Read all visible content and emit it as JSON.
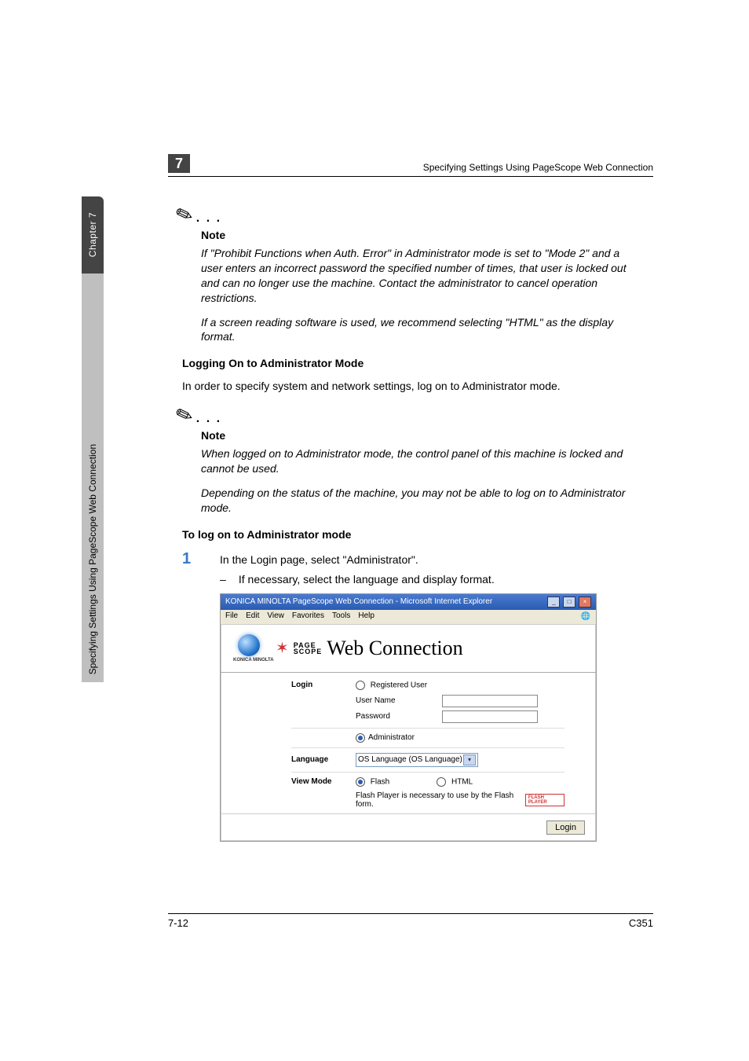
{
  "sidebar": {
    "chapter_label": "Chapter 7",
    "section_label": "Specifying Settings Using PageScope Web Connection"
  },
  "header": {
    "chapter_num": "7",
    "running_title": "Specifying Settings Using PageScope Web Connection"
  },
  "note1": {
    "label": "Note",
    "para1": "If \"Prohibit Functions when Auth. Error\" in Administrator mode is set to \"Mode 2\" and a user enters an incorrect password the specified number of times, that user is locked out and can no longer use the machine. Contact the administrator to cancel operation restrictions.",
    "para2": "If a screen reading software is used, we recommend selecting \"HTML\" as the display format."
  },
  "section1": {
    "heading": "Logging On to Administrator Mode",
    "body": "In order to specify system and network settings, log on to Administrator mode."
  },
  "note2": {
    "label": "Note",
    "para1": "When logged on to Administrator mode, the control panel of this machine is locked and cannot be used.",
    "para2": "Depending on the status of the machine, you may not be able to log on to Administrator mode."
  },
  "section2": {
    "heading": "To log on to Administrator mode"
  },
  "step1": {
    "num": "1",
    "text": "In the Login page, select \"Administrator\".",
    "sub": "If necessary, select the language and display format."
  },
  "screenshot": {
    "titlebar": "KONICA MINOLTA PageScope Web Connection - Microsoft Internet Explorer",
    "menu": {
      "file": "File",
      "edit": "Edit",
      "view": "View",
      "favorites": "Favorites",
      "tools": "Tools",
      "help": "Help"
    },
    "brand_logo_text": "KONICA MINOLTA",
    "brand_ps_line1": "PAGE",
    "brand_ps_line2": "SCOPE",
    "brand_product": "Web Connection",
    "login_label": "Login",
    "registered_user": "Registered User",
    "user_name_label": "User Name",
    "password_label": "Password",
    "administrator_label": "Administrator",
    "language_label": "Language",
    "language_value": "OS Language (OS Language)",
    "viewmode_label": "View Mode",
    "flash_label": "Flash",
    "html_label": "HTML",
    "flash_notice": "Flash Player is necessary to use by the Flash form.",
    "flash_badge": "FLASH PLAYER",
    "login_button": "Login"
  },
  "footer": {
    "page_num": "7-12",
    "model": "C351"
  }
}
